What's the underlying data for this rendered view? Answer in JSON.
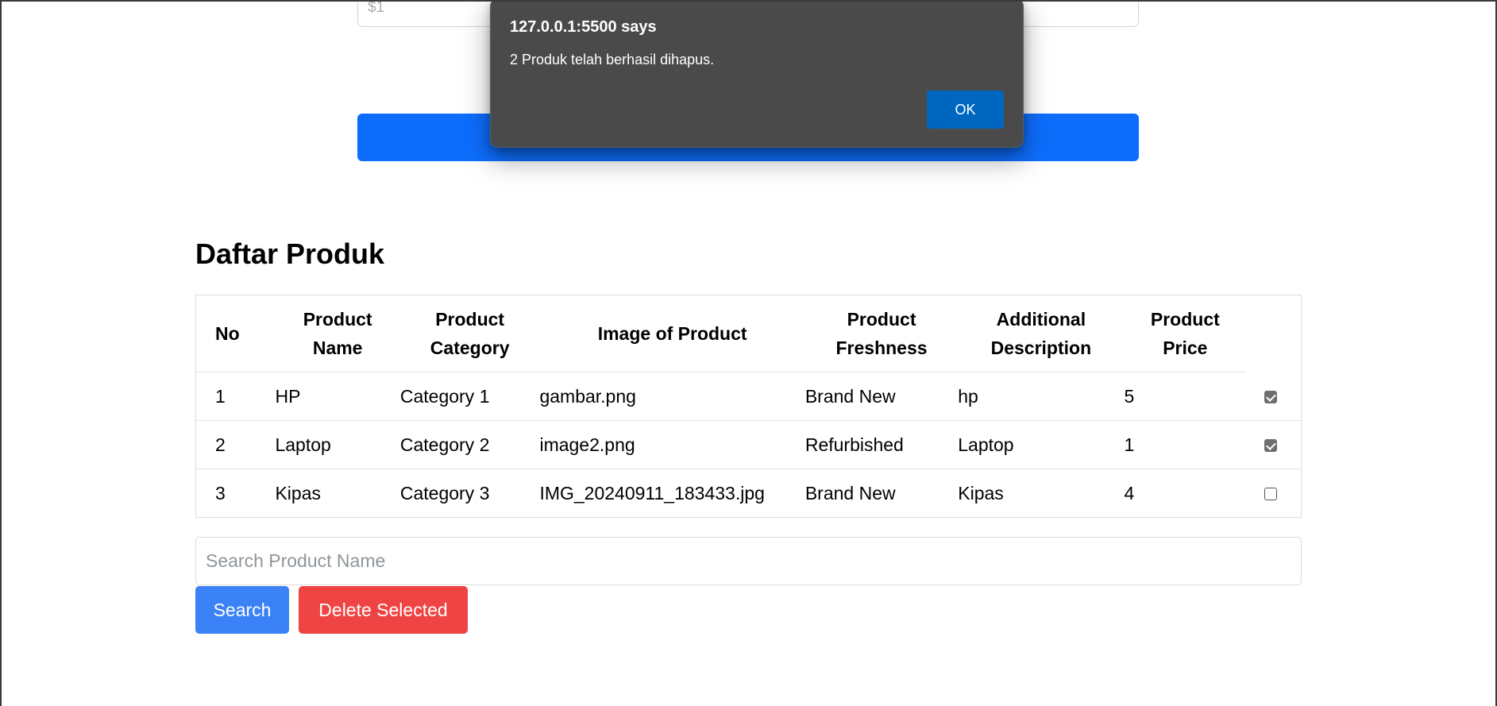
{
  "form": {
    "price_placeholder": "$1"
  },
  "products": {
    "heading": "Daftar Produk",
    "columns": {
      "no": "No",
      "name_line1": "Product",
      "name_line2": "Name",
      "category_line1": "Product",
      "category_line2": "Category",
      "image": "Image of Product",
      "freshness_line1": "Product",
      "freshness_line2": "Freshness",
      "description_line1": "Additional",
      "description_line2": "Description",
      "price_line1": "Product",
      "price_line2": "Price"
    },
    "rows": [
      {
        "no": "1",
        "name": "HP",
        "category": "Category 1",
        "image": "gambar.png",
        "freshness": "Brand New",
        "description": "hp",
        "price": "5",
        "selected": true
      },
      {
        "no": "2",
        "name": "Laptop",
        "category": "Category 2",
        "image": "image2.png",
        "freshness": "Refurbished",
        "description": "Laptop",
        "price": "1",
        "selected": true
      },
      {
        "no": "3",
        "name": "Kipas",
        "category": "Category 3",
        "image": "IMG_20240911_183433.jpg",
        "freshness": "Brand New",
        "description": "Kipas",
        "price": "4",
        "selected": false
      }
    ]
  },
  "search": {
    "placeholder": "Search Product Name",
    "search_label": "Search",
    "delete_label": "Delete Selected"
  },
  "alert": {
    "title": "127.0.0.1:5500 says",
    "message": "2 Produk telah berhasil dihapus.",
    "ok_label": "OK"
  },
  "colors": {
    "primary": "#0d6efd",
    "search_button": "#3b82f6",
    "delete_button": "#ef4444",
    "dialog_bg": "#4a4a4a",
    "dialog_button": "#0067c0"
  }
}
